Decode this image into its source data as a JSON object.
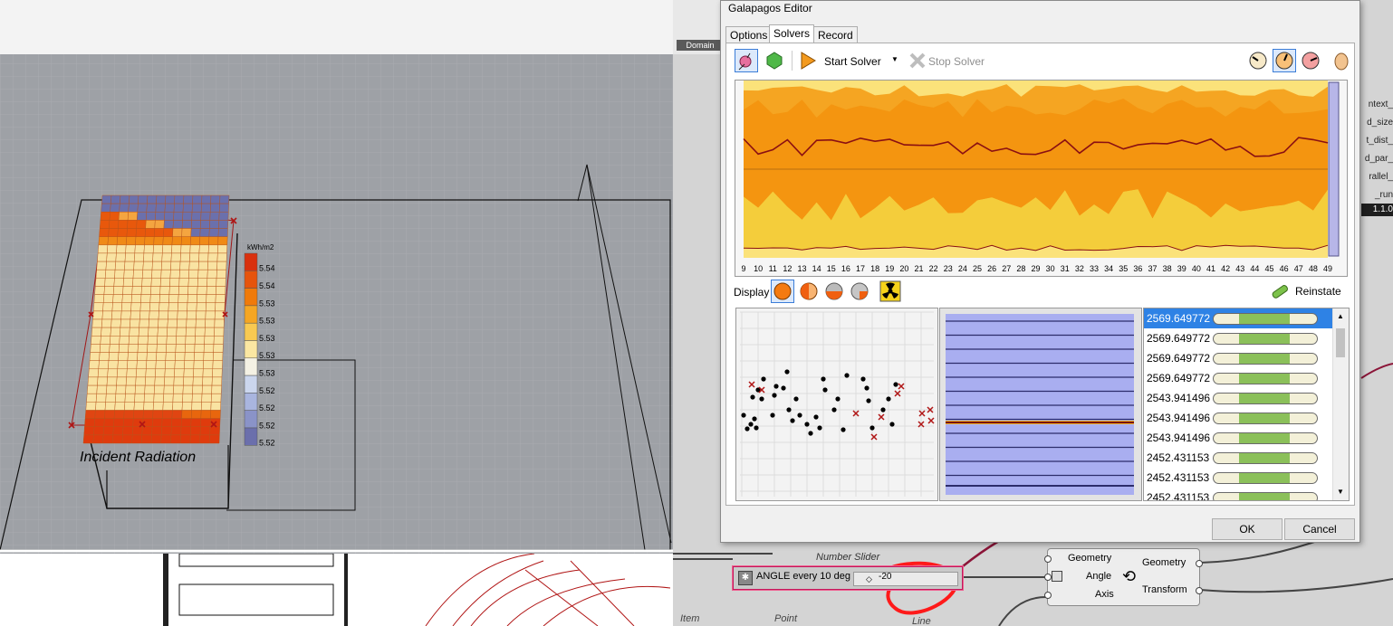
{
  "viewport": {
    "caption": "Incident Radiation",
    "legend_unit": "kWh/m2",
    "legend_values": [
      "5.54",
      "5.54",
      "5.53",
      "5.53",
      "5.53",
      "5.53",
      "5.53",
      "5.52",
      "5.52",
      "5.52",
      "5.52"
    ],
    "legend_colors": [
      "#d9300e",
      "#e6540c",
      "#f07a0a",
      "#f5a623",
      "#f8c951",
      "#fbe7a2",
      "#f4f1e4",
      "#cbd6ee",
      "#a9b5df",
      "#8a93c8",
      "#6b6fac"
    ]
  },
  "grasshopper": {
    "domain_label": "Domain",
    "right_labels": [
      "ntext_",
      "d_size",
      "t_dist_",
      "d_par_",
      "rallel_",
      "_run"
    ],
    "version": "1.1.0",
    "slider_caption": "Number Slider",
    "slider_name": "ANGLE every 10 deg",
    "slider_value": "-20",
    "rotate_inputs": [
      "Geometry",
      "Angle",
      "Axis"
    ],
    "rotate_outputs": [
      "Geometry",
      "Transform"
    ],
    "bottom_labels": [
      "Item",
      "Point",
      "Line"
    ]
  },
  "galapagos": {
    "title": "Galapagos Editor",
    "tabs": [
      "Options",
      "Solvers",
      "Record"
    ],
    "active_tab": "Solvers",
    "start_label": "Start Solver",
    "stop_label": "Stop Solver",
    "display_label": "Display",
    "reinstate_label": "Reinstate",
    "generation_ticks": [
      "9",
      "10",
      "11",
      "12",
      "13",
      "14",
      "15",
      "16",
      "17",
      "18",
      "19",
      "20",
      "21",
      "22",
      "23",
      "24",
      "25",
      "26",
      "27",
      "28",
      "29",
      "30",
      "31",
      "32",
      "33",
      "34",
      "35",
      "36",
      "37",
      "38",
      "39",
      "40",
      "41",
      "42",
      "43",
      "44",
      "45",
      "46",
      "47",
      "48",
      "49"
    ],
    "fitness_values": [
      "2569.649772",
      "2569.649772",
      "2569.649772",
      "2569.649772",
      "2543.941496",
      "2543.941496",
      "2543.941496",
      "2452.431153",
      "2452.431153",
      "2452.431153"
    ],
    "ok_label": "OK",
    "cancel_label": "Cancel"
  }
}
